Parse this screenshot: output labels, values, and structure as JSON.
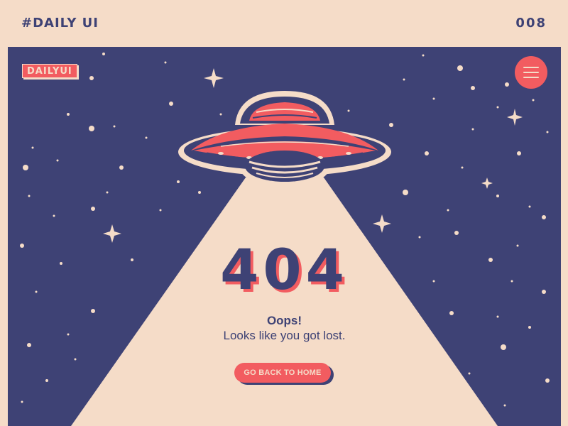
{
  "header": {
    "tag": "#DAILY UI",
    "number": "008"
  },
  "brand": {
    "logo_text": "DAILYUI"
  },
  "menu": {
    "icon": "hamburger-menu-icon"
  },
  "hero": {
    "illustration": "ufo-icon",
    "error_code": "404",
    "heading": "Oops!",
    "message": "Looks like you got lost.",
    "button_label": "GO BACK TO HOME"
  },
  "colors": {
    "background": "#f5dcc8",
    "space": "#3e4275",
    "accent": "#f25c60",
    "beam": "#f5dcc8"
  }
}
